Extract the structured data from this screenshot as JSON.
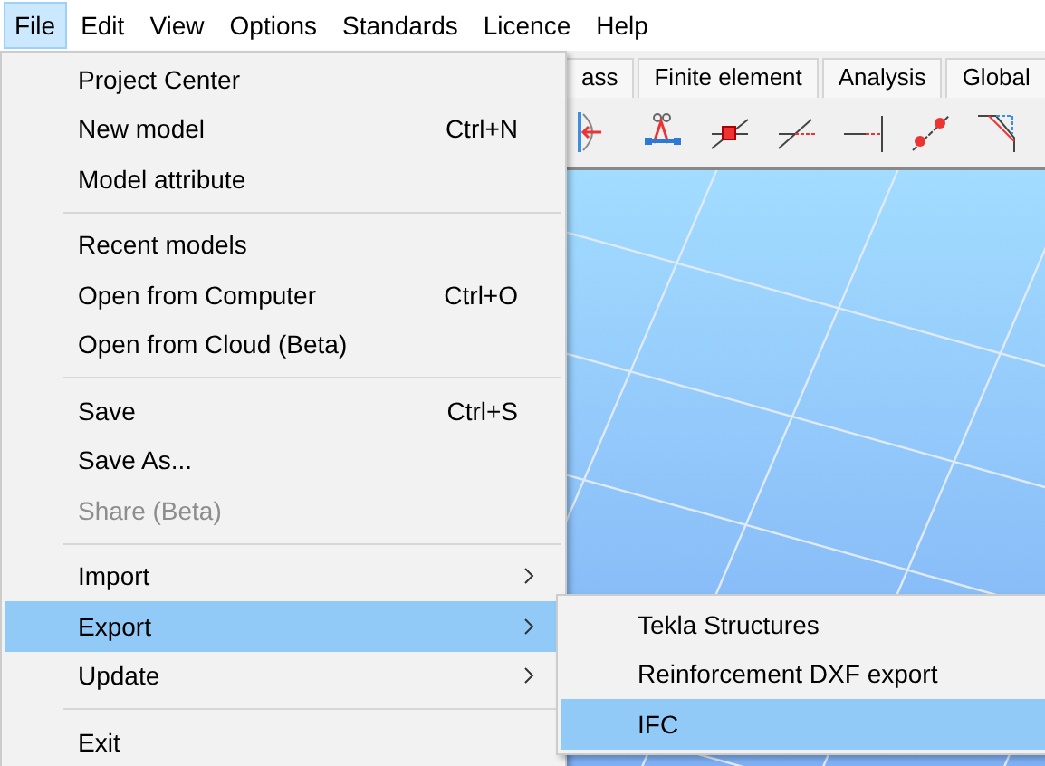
{
  "menubar": [
    {
      "label": "File",
      "selected": true
    },
    {
      "label": "Edit",
      "selected": false
    },
    {
      "label": "View",
      "selected": false
    },
    {
      "label": "Options",
      "selected": false
    },
    {
      "label": "Standards",
      "selected": false
    },
    {
      "label": "Licence",
      "selected": false
    },
    {
      "label": "Help",
      "selected": false
    }
  ],
  "tabs": [
    {
      "label": "ass"
    },
    {
      "label": "Finite element"
    },
    {
      "label": "Analysis"
    },
    {
      "label": "Global"
    }
  ],
  "file_menu": [
    {
      "kind": "item",
      "label": "Project Center",
      "selected": false,
      "disabled": false
    },
    {
      "kind": "item",
      "label": "New model",
      "shortcut": "Ctrl+N",
      "selected": false,
      "disabled": false
    },
    {
      "kind": "item",
      "label": "Model attribute",
      "selected": false,
      "disabled": false
    },
    {
      "kind": "separator"
    },
    {
      "kind": "item",
      "label": "Recent models",
      "selected": false,
      "disabled": false
    },
    {
      "kind": "item",
      "label": "Open from Computer",
      "shortcut": "Ctrl+O",
      "selected": false,
      "disabled": false
    },
    {
      "kind": "item",
      "label": "Open from Cloud (Beta)",
      "selected": false,
      "disabled": false
    },
    {
      "kind": "separator"
    },
    {
      "kind": "item",
      "label": "Save",
      "shortcut": "Ctrl+S",
      "selected": false,
      "disabled": false
    },
    {
      "kind": "item",
      "label": "Save As...",
      "selected": false,
      "disabled": false
    },
    {
      "kind": "item",
      "label": "Share (Beta)",
      "selected": false,
      "disabled": true
    },
    {
      "kind": "separator"
    },
    {
      "kind": "submenu",
      "label": "Import",
      "selected": false,
      "disabled": false
    },
    {
      "kind": "submenu",
      "label": "Export",
      "selected": true,
      "disabled": false
    },
    {
      "kind": "submenu",
      "label": "Update",
      "selected": false,
      "disabled": false
    },
    {
      "kind": "separator"
    },
    {
      "kind": "item",
      "label": "Exit",
      "selected": false,
      "disabled": false
    }
  ],
  "export_submenu": [
    {
      "label": "Tekla Structures",
      "selected": false
    },
    {
      "label": "Reinforcement DXF export",
      "selected": false
    },
    {
      "label": "IFC",
      "selected": true
    }
  ]
}
